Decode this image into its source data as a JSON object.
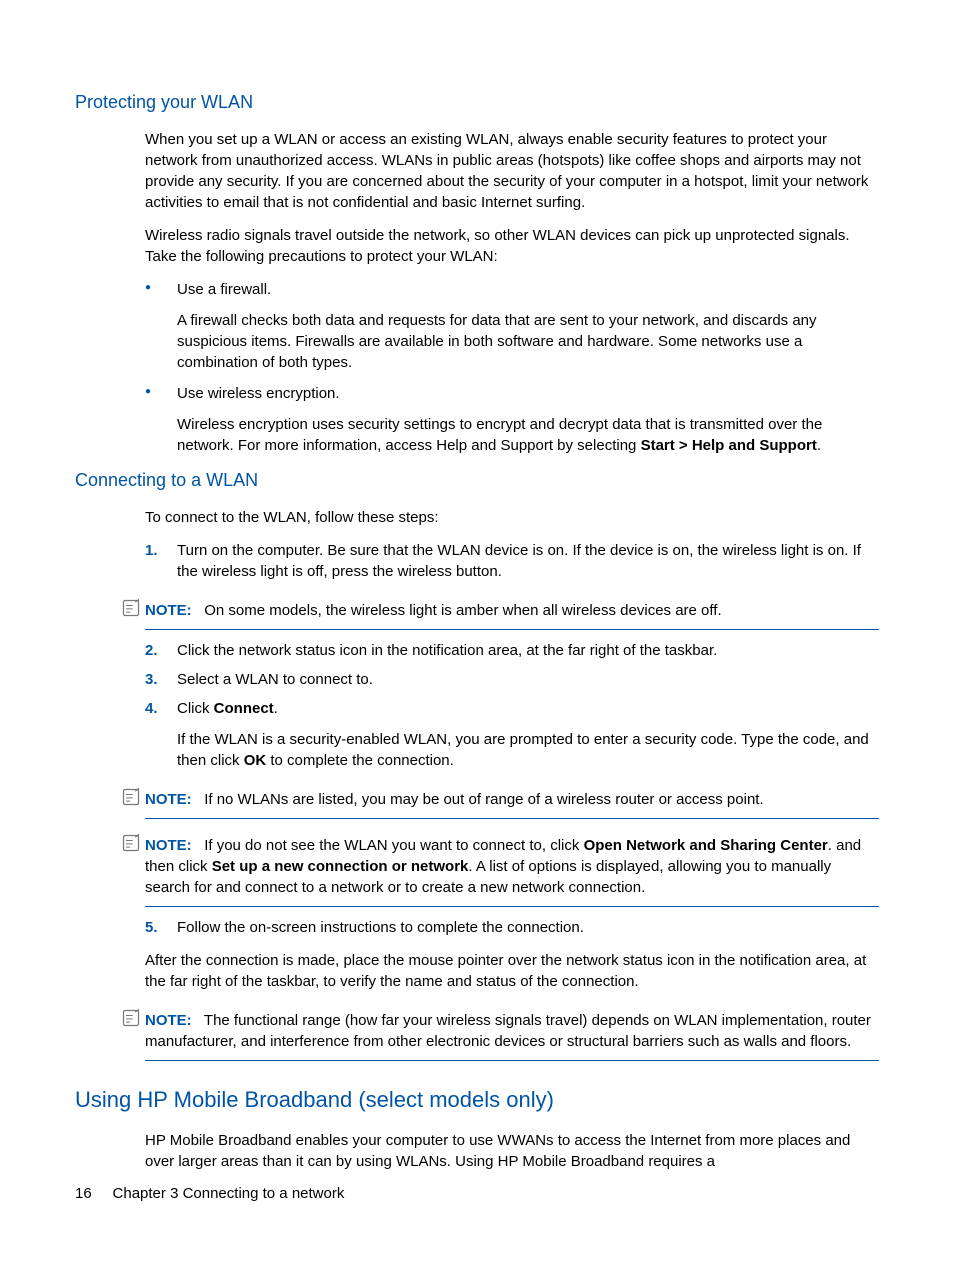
{
  "section1": {
    "heading": "Protecting your WLAN",
    "p1": "When you set up a WLAN or access an existing WLAN, always enable security features to protect your network from unauthorized access. WLANs in public areas (hotspots) like coffee shops and airports may not provide any security. If you are concerned about the security of your computer in a hotspot, limit your network activities to email that is not confidential and basic Internet surfing.",
    "p2": "Wireless radio signals travel outside the network, so other WLAN devices can pick up unprotected signals. Take the following precautions to protect your WLAN:",
    "bullets": {
      "b1": {
        "title": "Use a firewall.",
        "desc": "A firewall checks both data and requests for data that are sent to your network, and discards any suspicious items. Firewalls are available in both software and hardware. Some networks use a combination of both types."
      },
      "b2": {
        "title": "Use wireless encryption.",
        "desc_pre": "Wireless encryption uses security settings to encrypt and decrypt data that is transmitted over the network. For more information, access Help and Support by selecting ",
        "bold1": "Start > Help and Support",
        "desc_post": "."
      }
    }
  },
  "section2": {
    "heading": "Connecting to a WLAN",
    "intro": "To connect to the WLAN, follow these steps:",
    "step1": {
      "num": "1.",
      "text": "Turn on the computer. Be sure that the WLAN device is on. If the device is on, the wireless light is on. If the wireless light is off, press the wireless button."
    },
    "note1": {
      "label": "NOTE:",
      "text": "On some models, the wireless light is amber when all wireless devices are off."
    },
    "step2": {
      "num": "2.",
      "text": "Click the network status icon in the notification area, at the far right of the taskbar."
    },
    "step3": {
      "num": "3.",
      "text": "Select a WLAN to connect to."
    },
    "step4": {
      "num": "4.",
      "pre": "Click ",
      "bold": "Connect",
      "post": ".",
      "desc_pre": "If the WLAN is a security-enabled WLAN, you are prompted to enter a security code. Type the code, and then click ",
      "desc_bold": "OK",
      "desc_post": " to complete the connection."
    },
    "note2": {
      "label": "NOTE:",
      "text": "If no WLANs are listed, you may be out of range of a wireless router or access point."
    },
    "note3": {
      "label": "NOTE:",
      "s1": "If you do not see the WLAN you want to connect to, click ",
      "b1": "Open Network and Sharing Center",
      "s2": ". and then click ",
      "b2": "Set up a new connection or network",
      "s3": ". A list of options is displayed, allowing you to manually search for and connect to a network or to create a new network connection."
    },
    "step5": {
      "num": "5.",
      "text": "Follow the on-screen instructions to complete the connection."
    },
    "after": "After the connection is made, place the mouse pointer over the network status icon in the notification area, at the far right of the taskbar, to verify the name and status of the connection.",
    "note4": {
      "label": "NOTE:",
      "text": "The functional range (how far your wireless signals travel) depends on WLAN implementation, router manufacturer, and interference from other electronic devices or structural barriers such as walls and floors."
    }
  },
  "section3": {
    "heading": "Using HP Mobile Broadband (select models only)",
    "p1": "HP Mobile Broadband enables your computer to use WWANs to access the Internet from more places and over larger areas than it can by using WLANs. Using HP Mobile Broadband requires a"
  },
  "footer": {
    "page_num": "16",
    "chapter": "Chapter 3   Connecting to a network"
  }
}
